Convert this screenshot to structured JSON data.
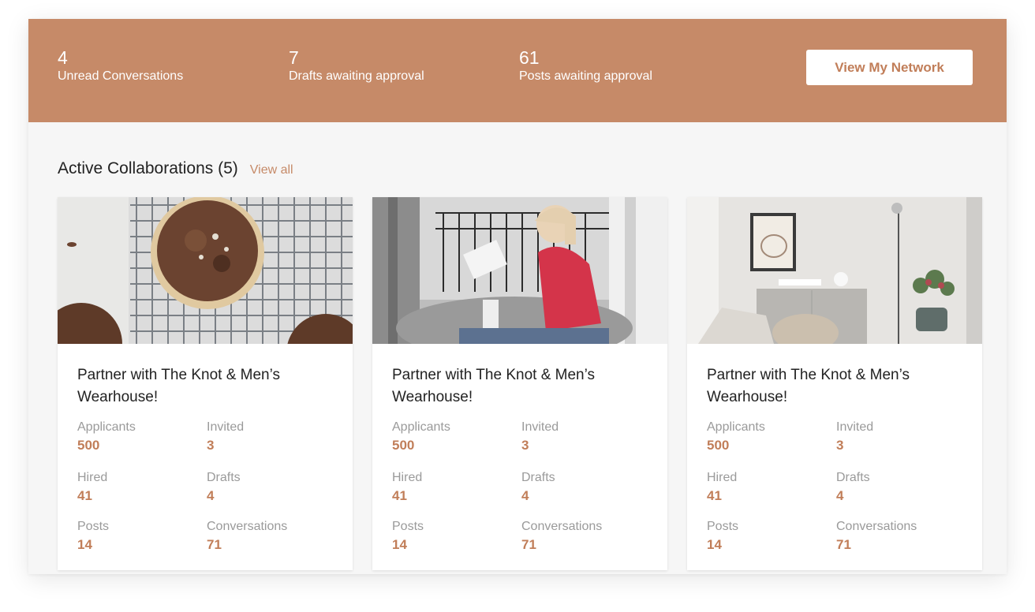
{
  "stats": [
    {
      "number": "4",
      "label": "Unread Conversations"
    },
    {
      "number": "7",
      "label": "Drafts awaiting approval"
    },
    {
      "number": "61",
      "label": "Posts awaiting approval"
    }
  ],
  "network_button": "View My Network",
  "section": {
    "title": "Active Collaborations (5)",
    "view_all": "View all"
  },
  "colors": {
    "accent": "#c68a68",
    "accent_text": "#c17e59",
    "background": "#f6f6f6"
  },
  "cards": [
    {
      "image": "muffins-photo",
      "title": "Partner with The Knot & Men’s Wearhouse!",
      "metrics": [
        {
          "label": "Applicants",
          "value": "500"
        },
        {
          "label": "Invited",
          "value": "3"
        },
        {
          "label": "Hired",
          "value": "41"
        },
        {
          "label": "Drafts",
          "value": "4"
        },
        {
          "label": "Posts",
          "value": "14"
        },
        {
          "label": "Conversations",
          "value": "71"
        }
      ]
    },
    {
      "image": "woman-reading-photo",
      "title": "Partner with The Knot & Men’s Wearhouse!",
      "metrics": [
        {
          "label": "Applicants",
          "value": "500"
        },
        {
          "label": "Invited",
          "value": "3"
        },
        {
          "label": "Hired",
          "value": "41"
        },
        {
          "label": "Drafts",
          "value": "4"
        },
        {
          "label": "Posts",
          "value": "14"
        },
        {
          "label": "Conversations",
          "value": "71"
        }
      ]
    },
    {
      "image": "interior-photo",
      "title": "Partner with The Knot & Men’s Wearhouse!",
      "metrics": [
        {
          "label": "Applicants",
          "value": "500"
        },
        {
          "label": "Invited",
          "value": "3"
        },
        {
          "label": "Hired",
          "value": "41"
        },
        {
          "label": "Drafts",
          "value": "4"
        },
        {
          "label": "Posts",
          "value": "14"
        },
        {
          "label": "Conversations",
          "value": "71"
        }
      ]
    }
  ]
}
